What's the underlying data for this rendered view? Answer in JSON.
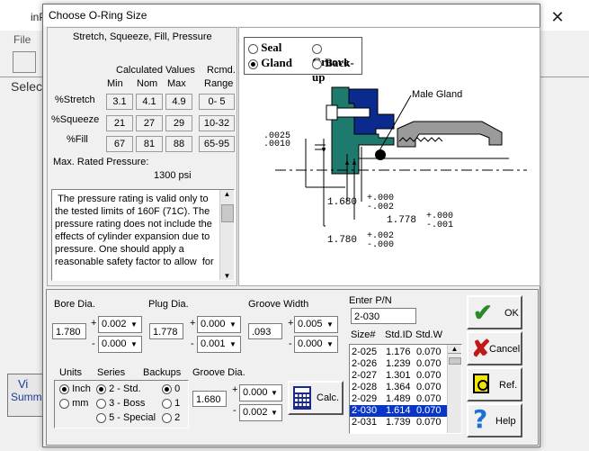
{
  "background_app": {
    "title": "inP",
    "menu_file": "File",
    "select_label": "Selec",
    "vi_label": "Vi",
    "summ_label": "Summ"
  },
  "dialog": {
    "title": "Choose O-Ring Size",
    "stretch_header": "Stretch, Squeeze, Fill, Pressure",
    "calc_header": "Calculated Values",
    "rcmd_header": "Rcmd.",
    "col_min": "Min",
    "col_nom": "Nom",
    "col_max": "Max",
    "col_range": "Range",
    "rows": [
      {
        "label": "%Stretch",
        "min": "3.1",
        "nom": "4.1",
        "max": "4.9",
        "range": "0- 5"
      },
      {
        "label": "%Squeeze",
        "min": "21",
        "nom": "27",
        "max": "29",
        "range": "10-32"
      },
      {
        "label": "%Fill",
        "min": "67",
        "nom": "81",
        "max": "88",
        "range": "65-95"
      }
    ],
    "max_pressure_label": "Max. Rated Pressure:",
    "max_pressure_value": "1300 psi",
    "note_text": " The pressure rating is valid only to the tested limits of 160F (71C). The pressure rating does not include the effects of cylinder expansion due to pressure. One should apply a reasonable safety factor to allow  for"
  },
  "mode_radios": {
    "seal": "Seal",
    "groove": "Groove",
    "gland": "Gland",
    "backup": "Back-up",
    "selected": "gland"
  },
  "drawing": {
    "male_gland": "Male Gland",
    "dim_0025": ".0025",
    "dim_0010": ".0010",
    "d1_value": "1.680",
    "d1_plus": "+.000",
    "d1_minus": "-.002",
    "d2_value": "1.778",
    "d2_plus": "+.000",
    "d2_minus": "-.001",
    "d3_value": "1.780",
    "d3_plus": "+.002",
    "d3_minus": "-.000"
  },
  "inputs": {
    "bore_label": "Bore Dia.",
    "bore_value": "1.780",
    "bore_plus": "0.002",
    "bore_minus": "0.000",
    "plug_label": "Plug Dia.",
    "plug_value": "1.778",
    "plug_plus": "0.000",
    "plug_minus": "0.001",
    "groove_width_label": "Groove Width",
    "groove_width_value": ".093",
    "gw_plus": "0.005",
    "gw_minus": "0.000",
    "groove_dia_label": "Groove Dia.",
    "groove_dia_value": "1.680",
    "gd_plus": "0.000",
    "gd_minus": "0.002",
    "calc_label": "Calc.",
    "plus_sign": "+",
    "minus_sign": "-"
  },
  "units": {
    "units_label": "Units",
    "inch": "Inch",
    "mm": "mm",
    "series_label": "Series",
    "series_2": "2 - Std.",
    "series_3": "3 - Boss",
    "series_5": "5 - Special",
    "backups_label": "Backups",
    "backup_0": "0",
    "backup_1": "1",
    "backup_2": "2"
  },
  "pn": {
    "enter_label": "Enter P/N",
    "value": "2-030",
    "col_size": "Size#",
    "col_id": "Std.ID",
    "col_w": "Std.W",
    "rows": [
      {
        "size": "2-025",
        "id": "1.176",
        "w": "0.070"
      },
      {
        "size": "2-026",
        "id": "1.239",
        "w": "0.070"
      },
      {
        "size": "2-027",
        "id": "1.301",
        "w": "0.070"
      },
      {
        "size": "2-028",
        "id": "1.364",
        "w": "0.070"
      },
      {
        "size": "2-029",
        "id": "1.489",
        "w": "0.070"
      },
      {
        "size": "2-030",
        "id": "1.614",
        "w": "0.070"
      },
      {
        "size": "2-031",
        "id": "1.739",
        "w": "0.070"
      }
    ],
    "selected_index": 5
  },
  "buttons": {
    "ok": "OK",
    "cancel": "Cancel",
    "ref": "Ref.",
    "help": "Help"
  },
  "colors": {
    "teal": "#1f7a6e",
    "navy": "#0b2a8e",
    "selection": "#0a36c8"
  }
}
